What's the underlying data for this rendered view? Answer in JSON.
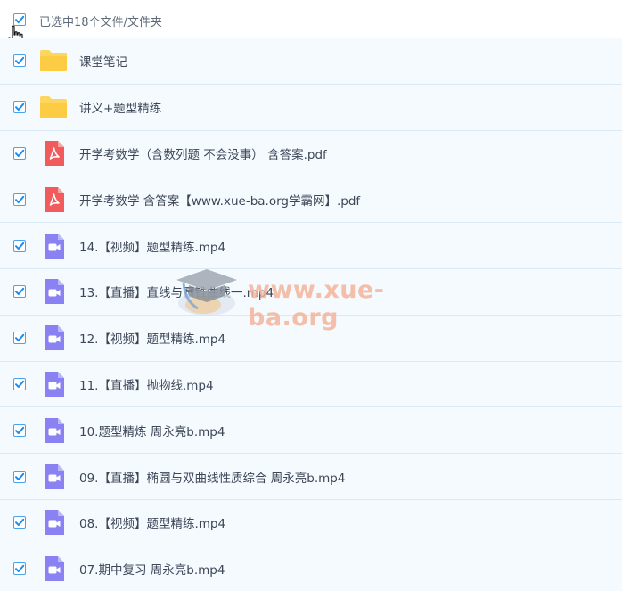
{
  "header": {
    "selection_text": "已选中18个文件/文件夹",
    "checked": true
  },
  "colors": {
    "checkbox_border": "#4ba3ec",
    "checkmark": "#1a8ef0",
    "folder": "#fdd65f",
    "pdf": "#f25b5b",
    "video": "#8a82f2",
    "row_bg": "#f5faff",
    "row_border": "#dbe8f5"
  },
  "files": [
    {
      "name": "课堂笔记",
      "type": "folder",
      "icon": "folder-icon",
      "checked": true
    },
    {
      "name": "讲义+题型精练",
      "type": "folder",
      "icon": "folder-icon",
      "checked": true
    },
    {
      "name": "开学考数学（含数列题 不会没事） 含答案.pdf",
      "type": "pdf",
      "icon": "pdf-icon",
      "checked": true
    },
    {
      "name": "开学考数学 含答案【www.xue-ba.org学霸网】.pdf",
      "type": "pdf",
      "icon": "pdf-icon",
      "checked": true
    },
    {
      "name": "14.【视频】题型精练.mp4",
      "type": "video",
      "icon": "video-icon",
      "checked": true
    },
    {
      "name": "13.【直播】直线与圆锥曲线一.mp4",
      "type": "video",
      "icon": "video-icon",
      "checked": true
    },
    {
      "name": "12.【视频】题型精练.mp4",
      "type": "video",
      "icon": "video-icon",
      "checked": true
    },
    {
      "name": "11.【直播】抛物线.mp4",
      "type": "video",
      "icon": "video-icon",
      "checked": true
    },
    {
      "name": "10.题型精炼 周永亮b.mp4",
      "type": "video",
      "icon": "video-icon",
      "checked": true
    },
    {
      "name": "09.【直播】椭圆与双曲线性质综合 周永亮b.mp4",
      "type": "video",
      "icon": "video-icon",
      "checked": true
    },
    {
      "name": "08.【视频】题型精练.mp4",
      "type": "video",
      "icon": "video-icon",
      "checked": true
    },
    {
      "name": "07.期中复习 周永亮b.mp4",
      "type": "video",
      "icon": "video-icon",
      "checked": true
    }
  ],
  "watermark": {
    "text": "www.xue-ba.org",
    "icon": "graduation-cap-icon"
  }
}
